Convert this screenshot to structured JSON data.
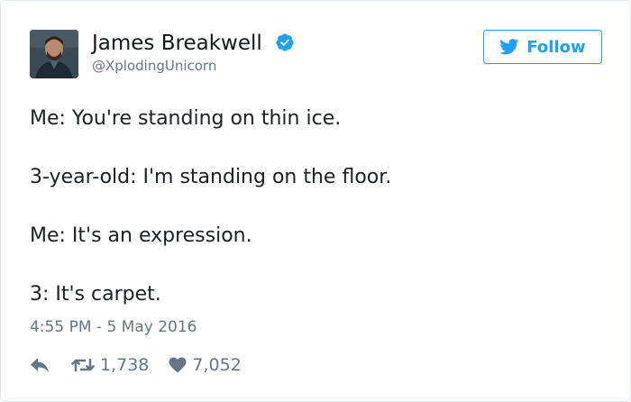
{
  "author": {
    "name": "James Breakwell",
    "handle": "@XplodingUnicorn",
    "avatar_icon": "profile-photo",
    "verified_icon": "verified-badge-icon"
  },
  "follow_button": {
    "label": "Follow",
    "icon": "twitter-bird-icon"
  },
  "tweet": {
    "lines": [
      "Me: You're standing on thin ice.",
      "3-year-old: I'm standing on the floor.",
      "Me: It's an expression.",
      "3: It's carpet."
    ],
    "timestamp": "4:55 PM - 5 May 2016"
  },
  "actions": {
    "reply_icon": "reply-icon",
    "retweet_icon": "retweet-icon",
    "retweet_count": "1,738",
    "like_icon": "heart-icon",
    "like_count": "7,052"
  },
  "colors": {
    "brand_blue": "#1da1f2",
    "text": "#1c2022",
    "muted": "#657786",
    "border": "#e1e8ed"
  }
}
